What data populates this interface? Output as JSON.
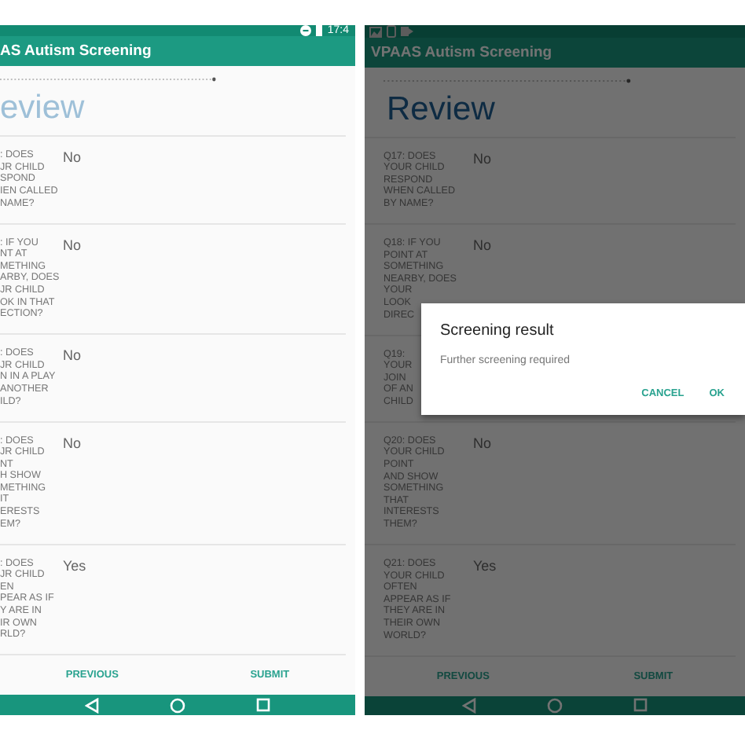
{
  "phones": [
    {
      "kind": "cropped",
      "status_bar": {
        "time": "17:4"
      },
      "title": "AS Autism Screening",
      "heading": "eview",
      "questions": [
        {
          "lines": [
            ": DOES",
            "JR CHILD",
            "SPOND",
            "IEN CALLED",
            "NAME?"
          ],
          "answer": "No"
        },
        {
          "lines": [
            ": IF YOU",
            "NT AT",
            "METHING",
            "ARBY, DOES",
            "JR CHILD",
            "OK IN THAT",
            "ECTION?"
          ],
          "answer": "No"
        },
        {
          "lines": [
            ": DOES",
            "JR CHILD",
            "N IN A PLAY",
            "ANOTHER",
            "ILD?"
          ],
          "answer": "No"
        },
        {
          "lines": [
            ": DOES",
            "JR CHILD",
            "NT",
            "H SHOW",
            "METHING",
            "IT",
            "ERESTS",
            "EM?"
          ],
          "answer": "No"
        },
        {
          "lines": [
            ": DOES",
            "JR CHILD",
            "EN",
            "PEAR AS IF",
            "Y ARE IN",
            "IR OWN",
            "RLD?"
          ],
          "answer": "Yes"
        }
      ],
      "buttons": [
        "PREVIOUS",
        "SUBMIT"
      ]
    },
    {
      "kind": "full",
      "title": "VPAAS Autism Screening",
      "heading": "Review",
      "questions": [
        {
          "lines": [
            "Q17: DOES",
            "YOUR CHILD",
            "RESPOND",
            "WHEN CALLED",
            "BY NAME?"
          ],
          "answer": "No"
        },
        {
          "lines": [
            "Q18: IF YOU",
            "POINT AT",
            "SOMETHING",
            "NEARBY, DOES",
            "YOUR",
            "LOOK",
            "DIREC"
          ],
          "answer": "No"
        },
        {
          "lines": [
            "Q19:",
            "YOUR",
            "JOIN",
            "OF AN",
            "CHILD"
          ]
        },
        {
          "lines": [
            "Q20: DOES",
            "YOUR CHILD",
            "POINT",
            "AND SHOW",
            "SOMETHING",
            "THAT",
            "INTERESTS",
            "THEM?"
          ],
          "answer": "No"
        },
        {
          "lines": [
            "Q21: DOES",
            "YOUR CHILD",
            "OFTEN",
            "APPEAR AS IF",
            "THEY ARE IN",
            "THEIR OWN",
            "WORLD?"
          ],
          "answer": "Yes"
        }
      ],
      "buttons": [
        "PREVIOUS",
        "SUBMIT"
      ],
      "dialog": {
        "title": "Screening result",
        "message": "Further screening required",
        "buttons": [
          "CANCEL",
          "OK"
        ]
      }
    }
  ]
}
